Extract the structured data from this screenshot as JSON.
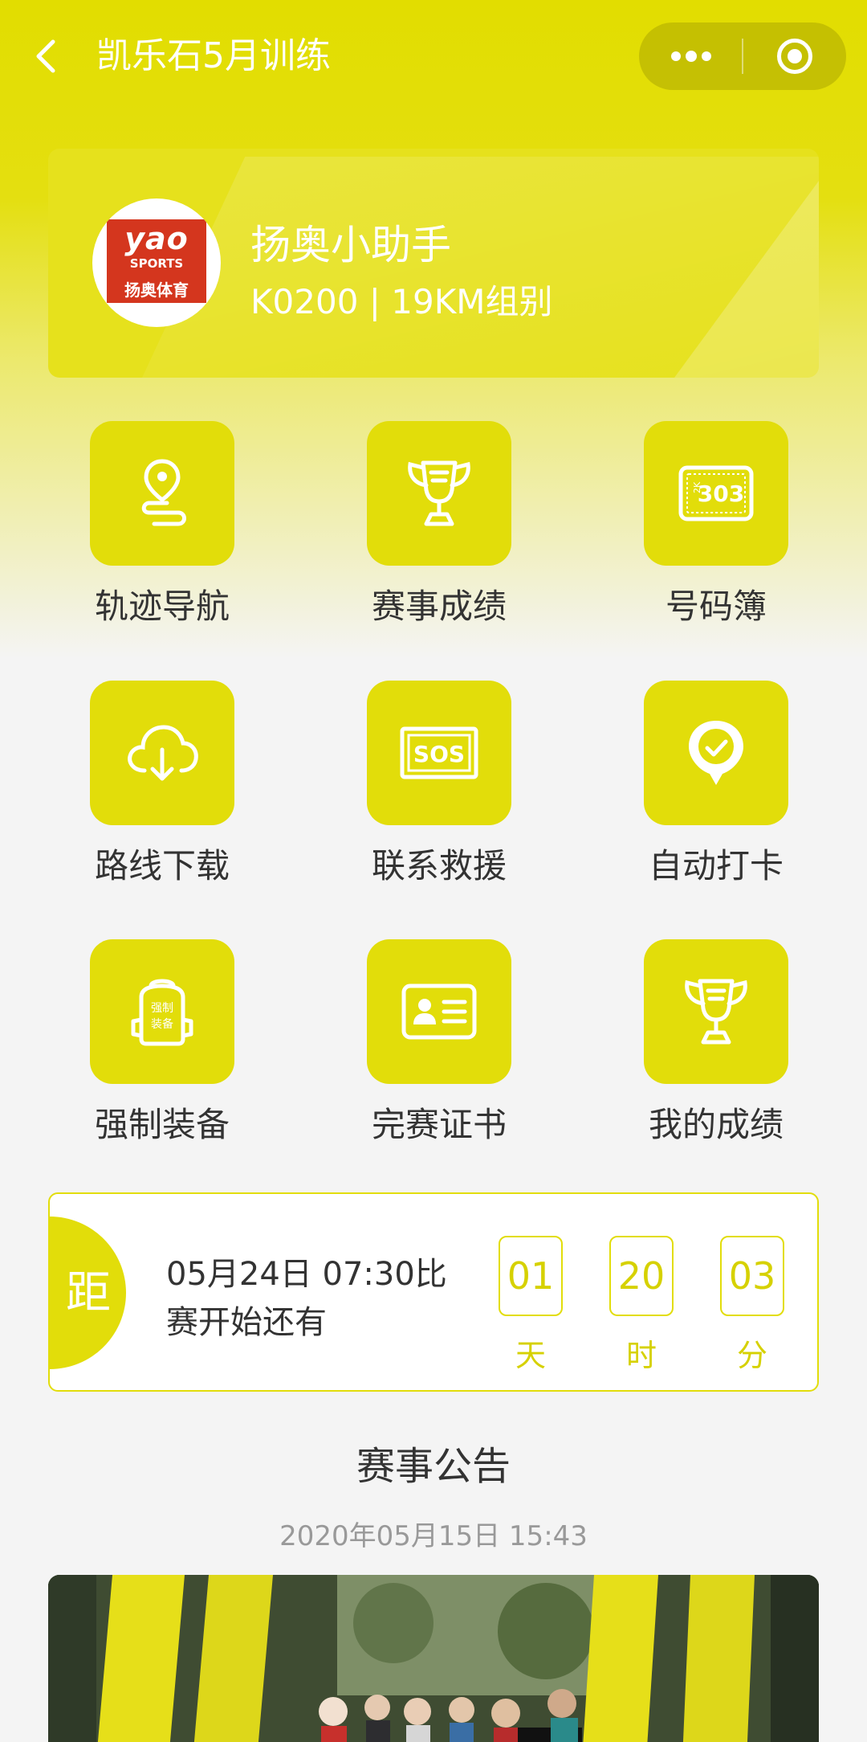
{
  "navbar": {
    "title": "凯乐石5月训练"
  },
  "profile": {
    "logo": {
      "line1": "yao",
      "line2": "SPORTS",
      "line3": "扬奥体育"
    },
    "name": "扬奥小助手",
    "sub": "K0200 | 19KM组别"
  },
  "grid": [
    {
      "label": "轨迹导航",
      "icon": "track-navigation-icon"
    },
    {
      "label": "赛事成绩",
      "icon": "trophy-icon"
    },
    {
      "label": "号码簿",
      "icon": "bib-number-icon",
      "bib_text": "303",
      "bib_prefix": "2K"
    },
    {
      "label": "路线下载",
      "icon": "cloud-download-icon"
    },
    {
      "label": "联系救援",
      "icon": "sos-icon",
      "sos_text": "SOS"
    },
    {
      "label": "自动打卡",
      "icon": "auto-checkin-icon"
    },
    {
      "label": "强制装备",
      "icon": "backpack-icon",
      "bag_text1": "强制",
      "bag_text2": "装备"
    },
    {
      "label": "完赛证书",
      "icon": "certificate-icon"
    },
    {
      "label": "我的成绩",
      "icon": "trophy-icon"
    }
  ],
  "countdown": {
    "badge": "距",
    "line1": "05月24日 07:30比",
    "line2": "赛开始还有",
    "units": [
      {
        "value": "01",
        "unit": "天"
      },
      {
        "value": "20",
        "unit": "时"
      },
      {
        "value": "03",
        "unit": "分"
      }
    ]
  },
  "notice": {
    "title": "赛事公告",
    "date": "2020年05月15日 15:43"
  },
  "colors": {
    "accent": "#e2dd0a",
    "accent_text": "#d6d100",
    "background": "#f4f4f4"
  }
}
